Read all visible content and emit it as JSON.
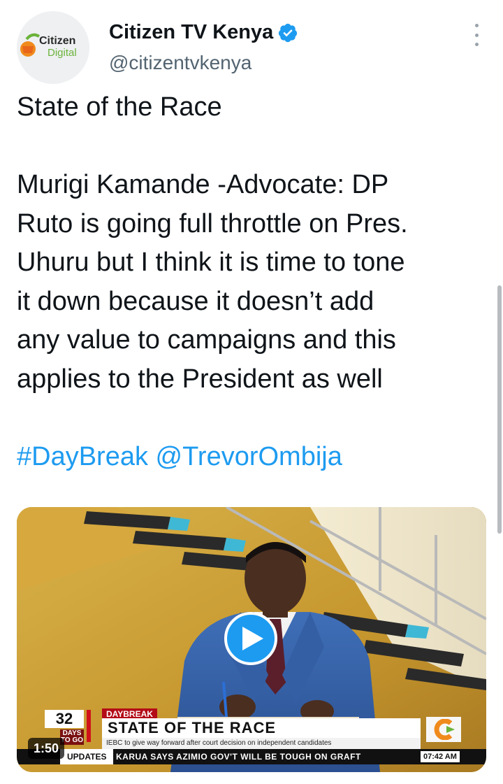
{
  "account": {
    "display_name": "Citizen TV Kenya",
    "handle": "@citizentvkenya",
    "verified": true,
    "avatar_text_line1": "Citizen",
    "avatar_text_line2": "Digital"
  },
  "tweet": {
    "title": "State of the Race",
    "body_lines": [
      "Murigi Kamande -Advocate: DP",
      "Ruto is going full throttle on Pres.",
      "Uhuru but I think it is time to tone",
      "it down because it doesn’t add",
      "any value to campaigns and this",
      "applies to the President as well"
    ],
    "hashtag": "#DayBreak",
    "mention": "@TrevorOmbija"
  },
  "video": {
    "duration": "1:50",
    "countdown_number": "32",
    "countdown_label_1": "DAYS",
    "countdown_label_2": "TO GO",
    "show_tag": "DAYBREAK",
    "headline": "STATE OF THE RACE",
    "subline": "IEBC to give way forward after court decision on independent candidates",
    "ticker_label": "UPDATES",
    "ticker_text": "KARUA SAYS AZIMIO GOV'T WILL BE TOUGH ON GRAFT",
    "ticker_time": "07:42 AM"
  },
  "colors": {
    "link": "#1d9bf0",
    "verified": "#1d9bf0",
    "text": "#0f1419",
    "secondary": "#536471"
  },
  "icons": {
    "verified": "verified-badge-icon",
    "more": "more-vertical-icon",
    "play": "play-icon"
  }
}
